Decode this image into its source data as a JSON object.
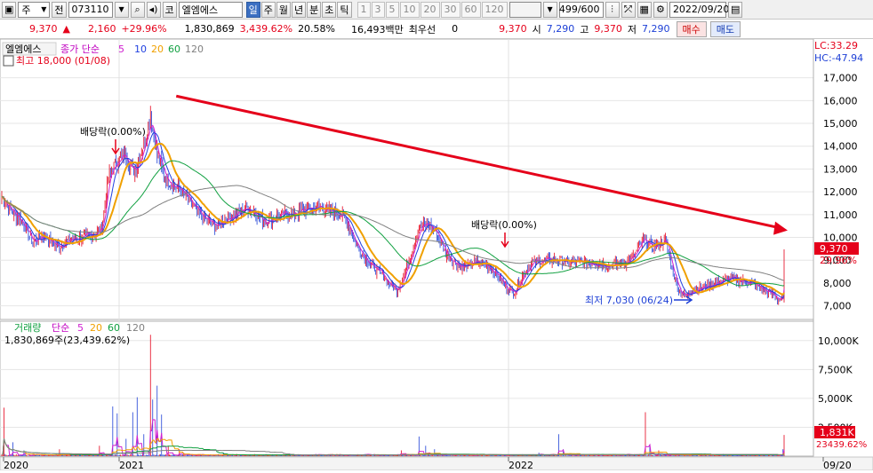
{
  "toolbar": {
    "type_select": "주",
    "prefix_label": "전",
    "code_value": "073110",
    "market_label": "코",
    "stock_name": "엘엠에스",
    "period_tabs": [
      "일",
      "주",
      "월",
      "년",
      "분",
      "초",
      "틱"
    ],
    "active_period": "일",
    "intervals": [
      "1",
      "3",
      "5",
      "10",
      "20",
      "30",
      "60",
      "120"
    ],
    "count_value": "499/600",
    "date_value": "2022/09/20"
  },
  "quote": {
    "price": "9,370",
    "change": "2,160",
    "change_pct": "+29.96%",
    "volume": "1,830,869",
    "volume_pct": "3,439.62%",
    "turnover_pct": "20.58%",
    "amount": "16,493백만",
    "credit_label": "최우선",
    "credit_value": "0",
    "last": "9,370",
    "open_label": "시",
    "open": "7,290",
    "high_label": "고",
    "high": "9,370",
    "low_label": "저",
    "low": "7,290",
    "buy_label": "매수",
    "sell_label": "매도"
  },
  "price_pane": {
    "legend": {
      "name": "엘엠에스",
      "kind": "종가 단순",
      "ma": [
        "5",
        "10",
        "20",
        "60",
        "120"
      ],
      "ma_colors": [
        "#d020d0",
        "#2040e0",
        "#f0a000",
        "#10a040",
        "#808080"
      ]
    },
    "lc_label": "LC:33.29",
    "hc_label": "HC:-47.94",
    "high_annotation": "최고 18,000 (01/08)",
    "low_annotation": "최저 7,030 (06/24)",
    "dividend_1": "배당락(0.00%)",
    "dividend_2": "배당락(0.00%)",
    "current_price_tag": "9,370",
    "current_pct_tag": "29.96%"
  },
  "volume_pane": {
    "legend_name": "거래량",
    "legend_kind": "단순",
    "ma": [
      "5",
      "20",
      "60",
      "120"
    ],
    "ma_colors": [
      "#d020d0",
      "#f0a000",
      "#10a040",
      "#808080"
    ],
    "value_label": "1,830,869주(23,439.62%)",
    "tag_value": "1,831K",
    "tag_pct": "23439.62%"
  },
  "x_axis": {
    "labels": [
      "2020",
      "2021",
      "2022",
      "09/20"
    ]
  },
  "chart_data": {
    "type": "candlestick",
    "price_axis": {
      "ticks": [
        7000,
        8000,
        9000,
        10000,
        11000,
        12000,
        13000,
        14000,
        15000,
        16000,
        17000
      ],
      "tick_labels": [
        "7,000",
        "8,000",
        "9,000",
        "10,000",
        "11,000",
        "12,000",
        "13,000",
        "14,000",
        "15,000",
        "16,000",
        "17,000"
      ],
      "range": [
        6400,
        18700
      ]
    },
    "volume_axis": {
      "ticks": [
        2500,
        5000,
        7500,
        10000
      ],
      "tick_labels": [
        "2,500K",
        "5,000K",
        "7,500K",
        "10,000K"
      ],
      "range": [
        0,
        10600
      ]
    },
    "x_range": [
      0,
      499
    ],
    "close_anchors": [
      [
        0,
        11800
      ],
      [
        8,
        11200
      ],
      [
        18,
        10700
      ],
      [
        28,
        9800
      ],
      [
        38,
        10100
      ],
      [
        50,
        9600
      ],
      [
        62,
        9900
      ],
      [
        72,
        10000
      ],
      [
        82,
        10100
      ],
      [
        90,
        10400
      ],
      [
        96,
        12600
      ],
      [
        104,
        13400
      ],
      [
        112,
        13600
      ],
      [
        118,
        12900
      ],
      [
        122,
        13200
      ],
      [
        128,
        14100
      ],
      [
        134,
        15300
      ],
      [
        140,
        13600
      ],
      [
        146,
        12800
      ],
      [
        152,
        12400
      ],
      [
        158,
        12200
      ],
      [
        164,
        11900
      ],
      [
        170,
        11500
      ],
      [
        178,
        11000
      ],
      [
        186,
        10700
      ],
      [
        194,
        10500
      ],
      [
        202,
        10800
      ],
      [
        210,
        11000
      ],
      [
        220,
        11300
      ],
      [
        228,
        11100
      ],
      [
        236,
        10700
      ],
      [
        244,
        10800
      ],
      [
        252,
        11000
      ],
      [
        262,
        11000
      ],
      [
        272,
        11200
      ],
      [
        282,
        11300
      ],
      [
        290,
        11300
      ],
      [
        298,
        11100
      ],
      [
        306,
        11000
      ],
      [
        312,
        10600
      ],
      [
        318,
        9800
      ],
      [
        326,
        9200
      ],
      [
        334,
        8700
      ],
      [
        342,
        8400
      ],
      [
        350,
        7900
      ],
      [
        356,
        7700
      ],
      [
        362,
        8300
      ],
      [
        368,
        9200
      ],
      [
        376,
        10400
      ],
      [
        384,
        10600
      ],
      [
        392,
        10200
      ],
      [
        400,
        9300
      ],
      [
        408,
        8900
      ],
      [
        416,
        8700
      ],
      [
        426,
        8900
      ],
      [
        436,
        8800
      ],
      [
        446,
        8400
      ],
      [
        454,
        7800
      ],
      [
        462,
        7600
      ],
      [
        470,
        8400
      ],
      [
        478,
        8900
      ],
      [
        488,
        9000
      ],
      [
        500,
        9000
      ],
      [
        512,
        8900
      ],
      [
        524,
        8900
      ],
      [
        534,
        8900
      ],
      [
        544,
        8800
      ],
      [
        552,
        8800
      ],
      [
        562,
        8900
      ],
      [
        570,
        9200
      ],
      [
        578,
        9900
      ],
      [
        586,
        9600
      ],
      [
        592,
        9700
      ],
      [
        598,
        9900
      ],
      [
        604,
        8600
      ],
      [
        610,
        7700
      ],
      [
        616,
        7400
      ],
      [
        622,
        7700
      ],
      [
        632,
        7800
      ],
      [
        644,
        8000
      ],
      [
        656,
        8200
      ],
      [
        666,
        8100
      ],
      [
        676,
        8000
      ],
      [
        686,
        7700
      ],
      [
        694,
        7500
      ],
      [
        700,
        7300
      ],
      [
        704,
        7290
      ],
      [
        705,
        9370
      ]
    ],
    "volume_spikes": [
      [
        2,
        4200
      ],
      [
        10,
        1200
      ],
      [
        20,
        500
      ],
      [
        52,
        600
      ],
      [
        88,
        900
      ],
      [
        100,
        4300
      ],
      [
        104,
        3700
      ],
      [
        112,
        1500
      ],
      [
        118,
        3800
      ],
      [
        122,
        5100
      ],
      [
        128,
        1900
      ],
      [
        134,
        10500
      ],
      [
        136,
        4900
      ],
      [
        140,
        6100
      ],
      [
        144,
        3600
      ],
      [
        150,
        900
      ],
      [
        160,
        600
      ],
      [
        200,
        300
      ],
      [
        260,
        200
      ],
      [
        360,
        500
      ],
      [
        376,
        1700
      ],
      [
        382,
        900
      ],
      [
        390,
        600
      ],
      [
        484,
        300
      ],
      [
        502,
        1900
      ],
      [
        506,
        600
      ],
      [
        580,
        3800
      ],
      [
        584,
        900
      ],
      [
        592,
        500
      ],
      [
        650,
        200
      ],
      [
        704,
        600
      ],
      [
        705,
        1831
      ]
    ],
    "trendline": [
      [
        130,
        16200
      ],
      [
        700,
        10500
      ]
    ]
  }
}
